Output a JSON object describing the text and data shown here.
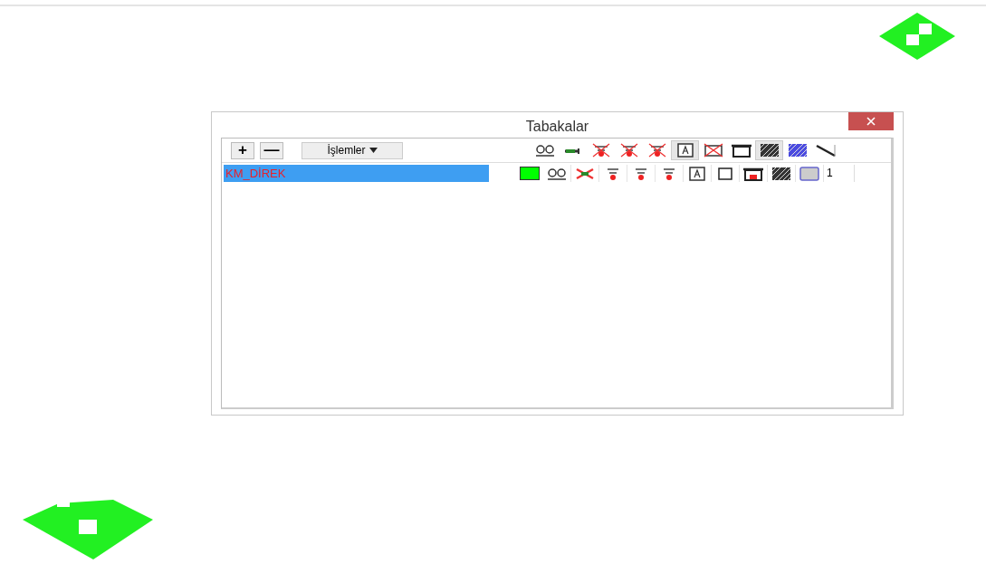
{
  "dialog": {
    "title": "Tabakalar"
  },
  "toolbar": {
    "add": "+",
    "remove": "—",
    "menu": "İşlemler"
  },
  "layers": [
    {
      "name": "KM_DİREK",
      "selected": true,
      "color": "#00ff00",
      "value": "1"
    }
  ]
}
